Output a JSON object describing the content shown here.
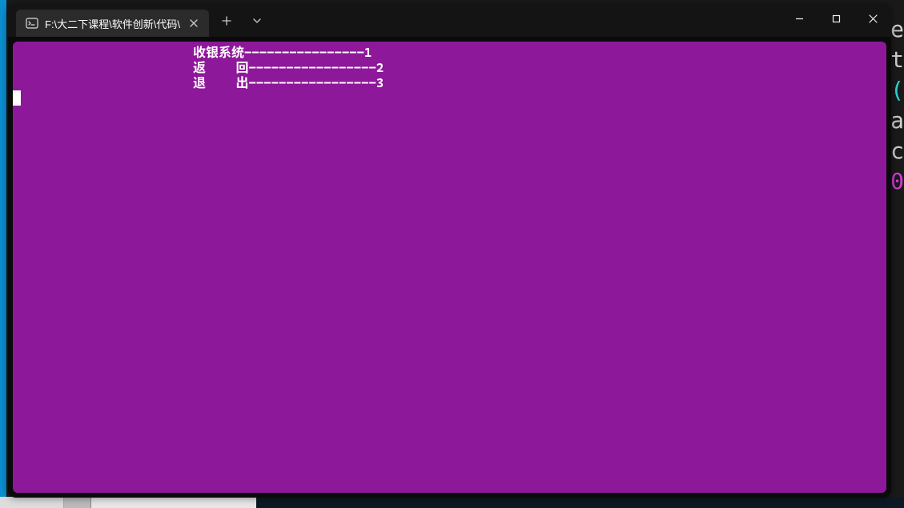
{
  "tab": {
    "title": "F:\\大二下课程\\软件创新\\代码\\"
  },
  "menu": {
    "indent": "                        ",
    "items": [
      {
        "label": "收银系统----------------1"
      },
      {
        "label": "返    回-----------------2"
      },
      {
        "label": "退    出-----------------3"
      }
    ]
  },
  "background_text": [
    "e",
    "t",
    "(",
    "a",
    "c",
    "0"
  ]
}
